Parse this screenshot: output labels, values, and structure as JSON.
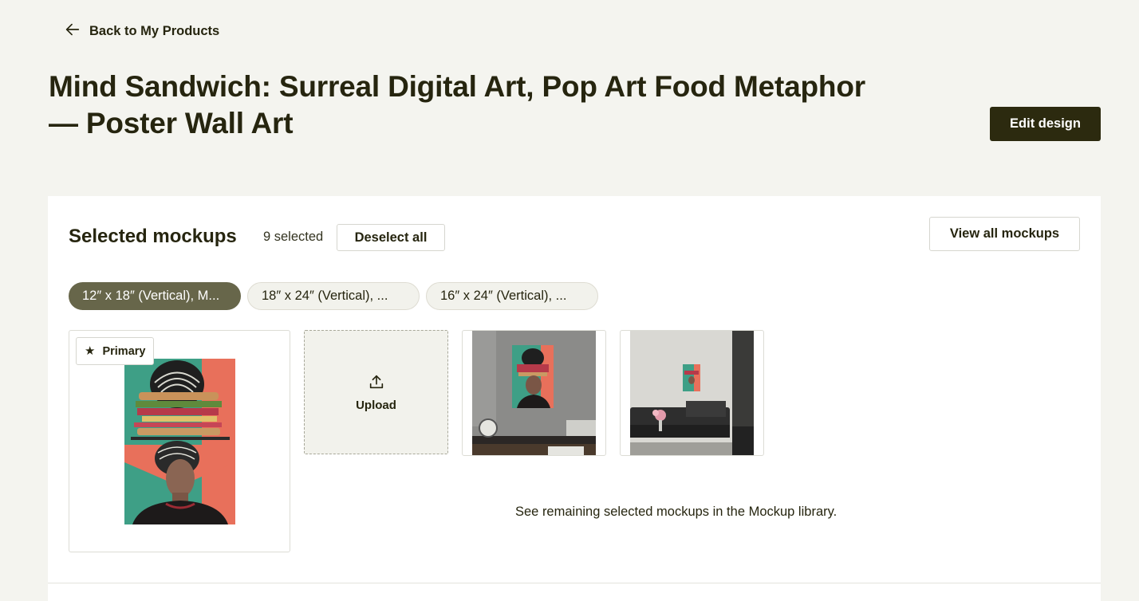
{
  "nav": {
    "back_label": "Back to My Products",
    "back_icon": "arrow-left-icon"
  },
  "page": {
    "title_line1": "Mind Sandwich: Surreal Digital Art, Pop Art Food Metaphor",
    "title_line2": "— Poster Wall Art",
    "edit_label": "Edit design"
  },
  "mockups": {
    "section_title": "Selected mockups",
    "selected_count": "9 selected",
    "deselect_label": "Deselect all",
    "view_all_label": "View all mockups",
    "chips": [
      {
        "label": "12″ x 18″ (Vertical), M...",
        "active": true
      },
      {
        "label": "18″ x 24″ (Vertical), ...",
        "active": false
      },
      {
        "label": "16″ x 24″ (Vertical), ...",
        "active": false
      }
    ],
    "primary_label": "Primary",
    "primary_icon": "star-icon",
    "upload_label": "Upload",
    "upload_icon": "upload-icon",
    "remaining_note": "See remaining selected mockups in the Mockup library."
  },
  "colors": {
    "background": "#f4f4ef",
    "primary_button": "#2c2a0f",
    "active_chip": "#67664a",
    "poster_teal": "#3e9f86",
    "poster_coral": "#e8705b"
  }
}
